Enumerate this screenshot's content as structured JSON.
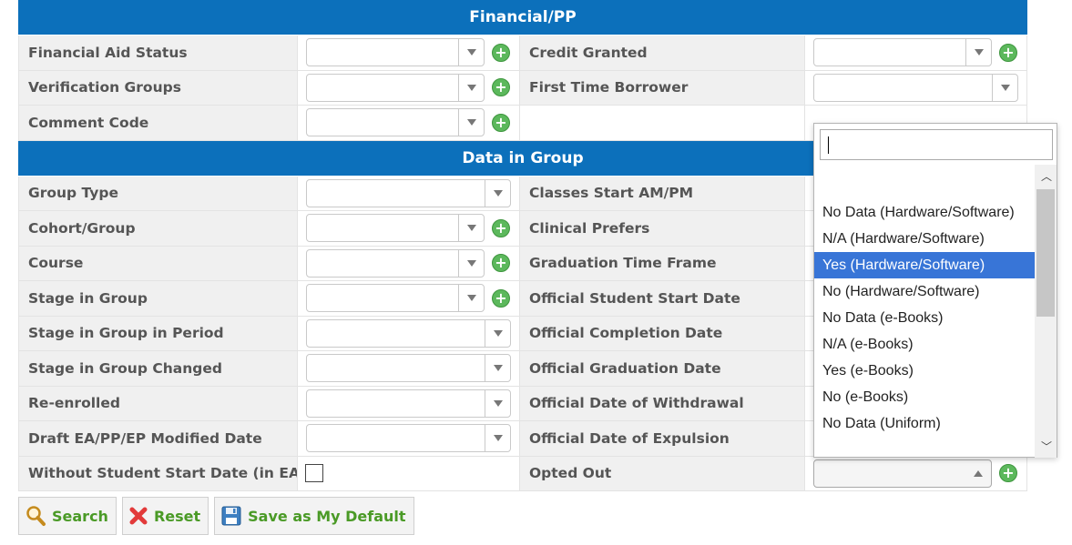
{
  "sections": {
    "financial": "Financial/PP",
    "data_in_group": "Data in Group"
  },
  "financial_rows": [
    {
      "left": "Financial Aid Status",
      "right": "Credit Granted"
    },
    {
      "left": "Verification Groups",
      "right": "First Time Borrower"
    },
    {
      "left": "Comment Code",
      "right": ""
    }
  ],
  "group_rows": [
    {
      "left": "Group Type",
      "right": "Classes Start AM/PM"
    },
    {
      "left": "Cohort/Group",
      "right": "Clinical Prefers"
    },
    {
      "left": "Course",
      "right": "Graduation Time Frame"
    },
    {
      "left": "Stage in Group",
      "right": "Official Student Start Date"
    },
    {
      "left": "Stage in Group in Period",
      "right": "Official Completion Date"
    },
    {
      "left": "Stage in Group Changed",
      "right": "Official Graduation Date"
    },
    {
      "left": "Re-enrolled",
      "right": "Official Date of Withdrawal"
    },
    {
      "left": "Draft EA/PP/EP Modified Date",
      "right": "Official Date of Expulsion"
    },
    {
      "left": "Without Student Start Date (in EA)",
      "right": "Opted Out"
    }
  ],
  "dropdown": {
    "search_value": "",
    "options": [
      "No Data (Hardware/Software)",
      "N/A (Hardware/Software)",
      "Yes (Hardware/Software)",
      "No (Hardware/Software)",
      "No Data (e-Books)",
      "N/A (e-Books)",
      "Yes (e-Books)",
      "No (e-Books)",
      "No Data (Uniform)"
    ],
    "highlighted": "Yes (Hardware/Software)"
  },
  "buttons": {
    "search": "Search",
    "reset": "Reset",
    "save_default": "Save as My Default"
  },
  "colors": {
    "header_bg": "#0c70bb",
    "plus_green": "#5cb85c",
    "button_text": "#4a9a26",
    "highlight": "#3875d7"
  },
  "icons": [
    "plus-circle-icon",
    "chevron-down-icon",
    "chevron-up-icon",
    "magnifier-icon",
    "red-x-icon",
    "floppy-disk-icon"
  ]
}
